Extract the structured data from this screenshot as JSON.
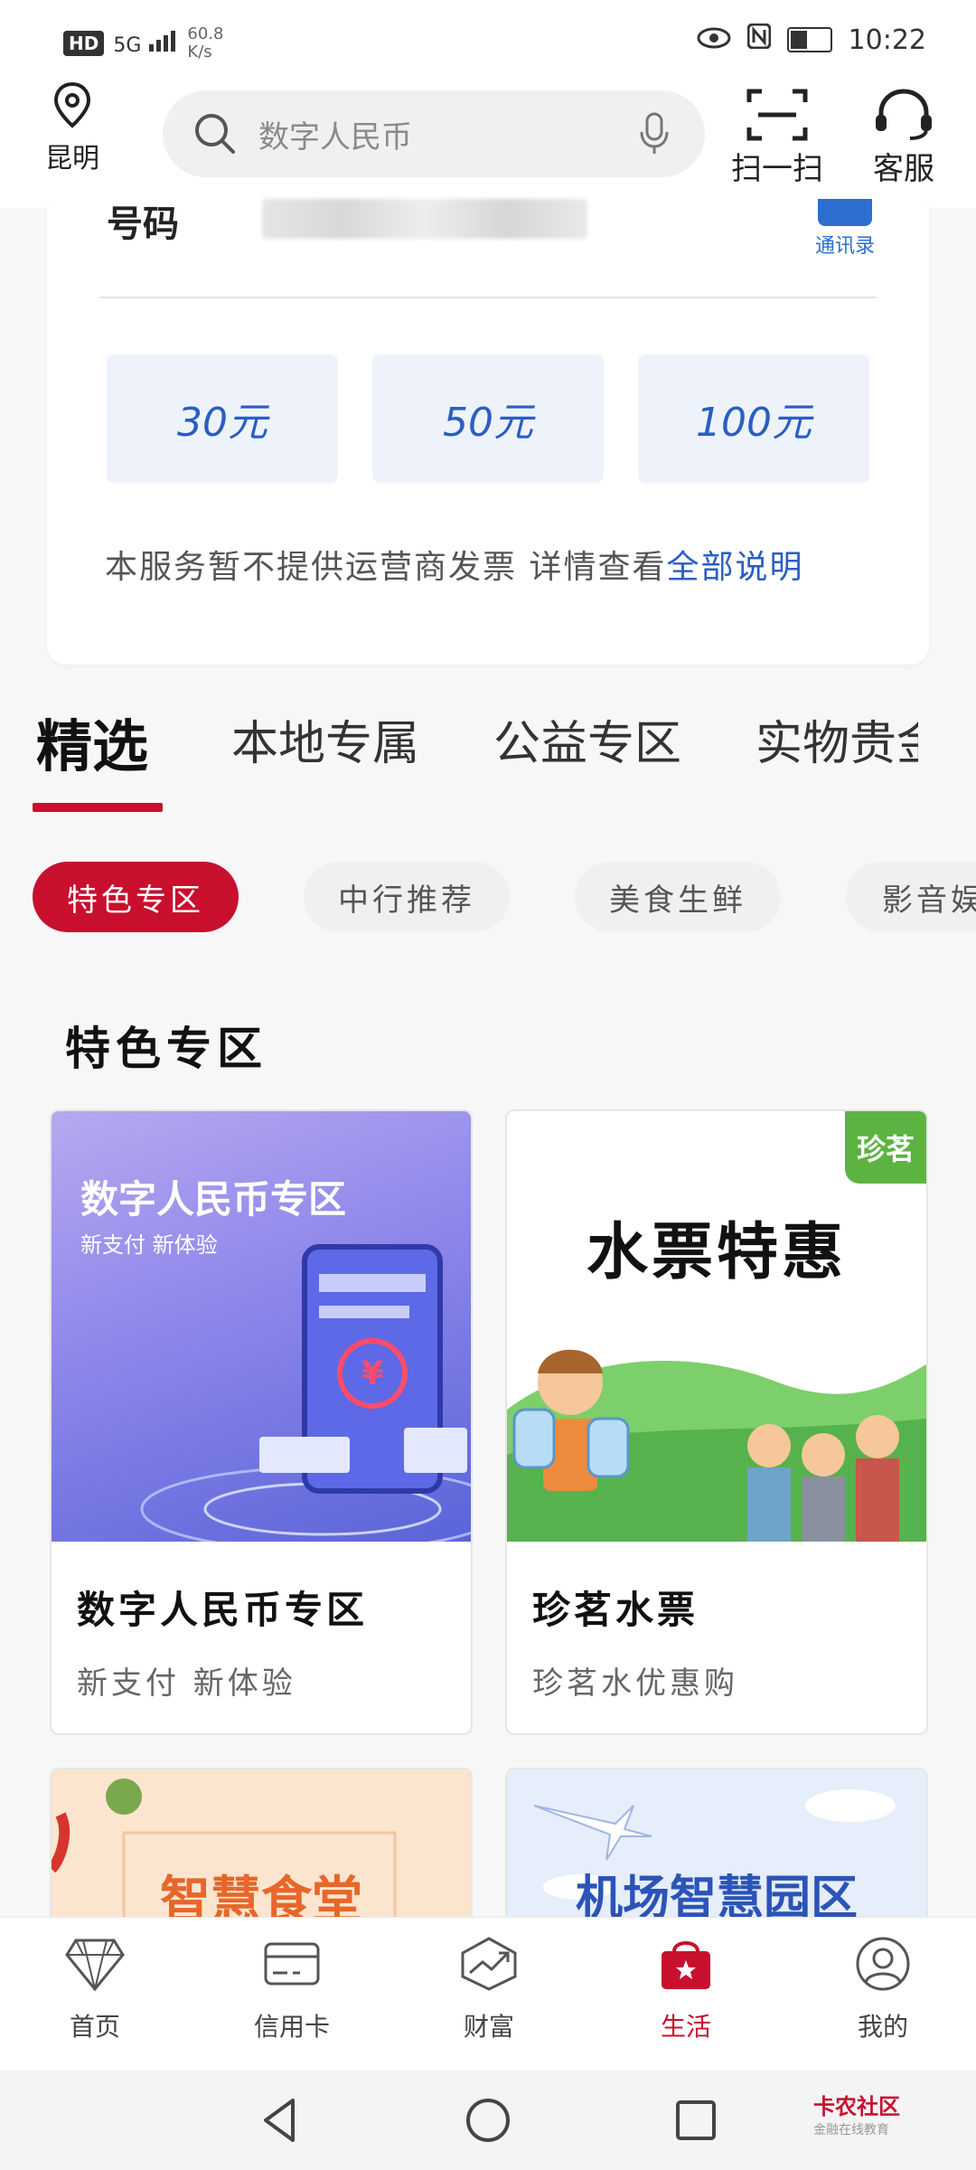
{
  "status_bar": {
    "network": "HD",
    "signal": "5G",
    "speed_value": "60.8",
    "speed_unit": "K/s",
    "time": "10:22"
  },
  "header": {
    "location": "昆明",
    "search_placeholder": "数字人民币",
    "scan_label": "扫一扫",
    "service_label": "客服"
  },
  "recharge": {
    "phone_label": "号码",
    "contacts_label": "通讯录",
    "amounts": [
      "30元",
      "50元",
      "100元"
    ],
    "notice_text": "本服务暂不提供运营商发票 详情查看",
    "notice_link": "全部说明"
  },
  "tabs": [
    {
      "label": "精选",
      "active": true
    },
    {
      "label": "本地专属",
      "active": false
    },
    {
      "label": "公益专区",
      "active": false
    },
    {
      "label": "实物贵金",
      "active": false
    }
  ],
  "chips": [
    {
      "label": "特色专区",
      "active": true
    },
    {
      "label": "中行推荐",
      "active": false
    },
    {
      "label": "美食生鲜",
      "active": false
    },
    {
      "label": "影音娱",
      "active": false
    }
  ],
  "section_title": "特色专区",
  "products": [
    {
      "image_title": "数字人民币专区",
      "image_subtitle": "新支付  新体验",
      "title": "数字人民币专区",
      "subtitle": "新支付 新体验"
    },
    {
      "image_title": "水票特惠",
      "image_brand": "珍茗",
      "title": "珍茗水票",
      "subtitle": "珍茗水优惠购"
    },
    {
      "image_title": "智慧食堂"
    },
    {
      "image_title": "机场智慧园区"
    }
  ],
  "bottom_nav": [
    {
      "label": "首页",
      "icon": "diamond-icon",
      "active": false
    },
    {
      "label": "信用卡",
      "icon": "credit-card-icon",
      "active": false
    },
    {
      "label": "财富",
      "icon": "wealth-chart-icon",
      "active": false
    },
    {
      "label": "生活",
      "icon": "shopping-bag-icon",
      "active": true
    },
    {
      "label": "我的",
      "icon": "user-icon",
      "active": false
    }
  ],
  "watermark": {
    "title": "卡农社区",
    "subtitle": "金融在线教育"
  },
  "colors": {
    "accent": "#c8102e",
    "link": "#2a5ec2"
  }
}
